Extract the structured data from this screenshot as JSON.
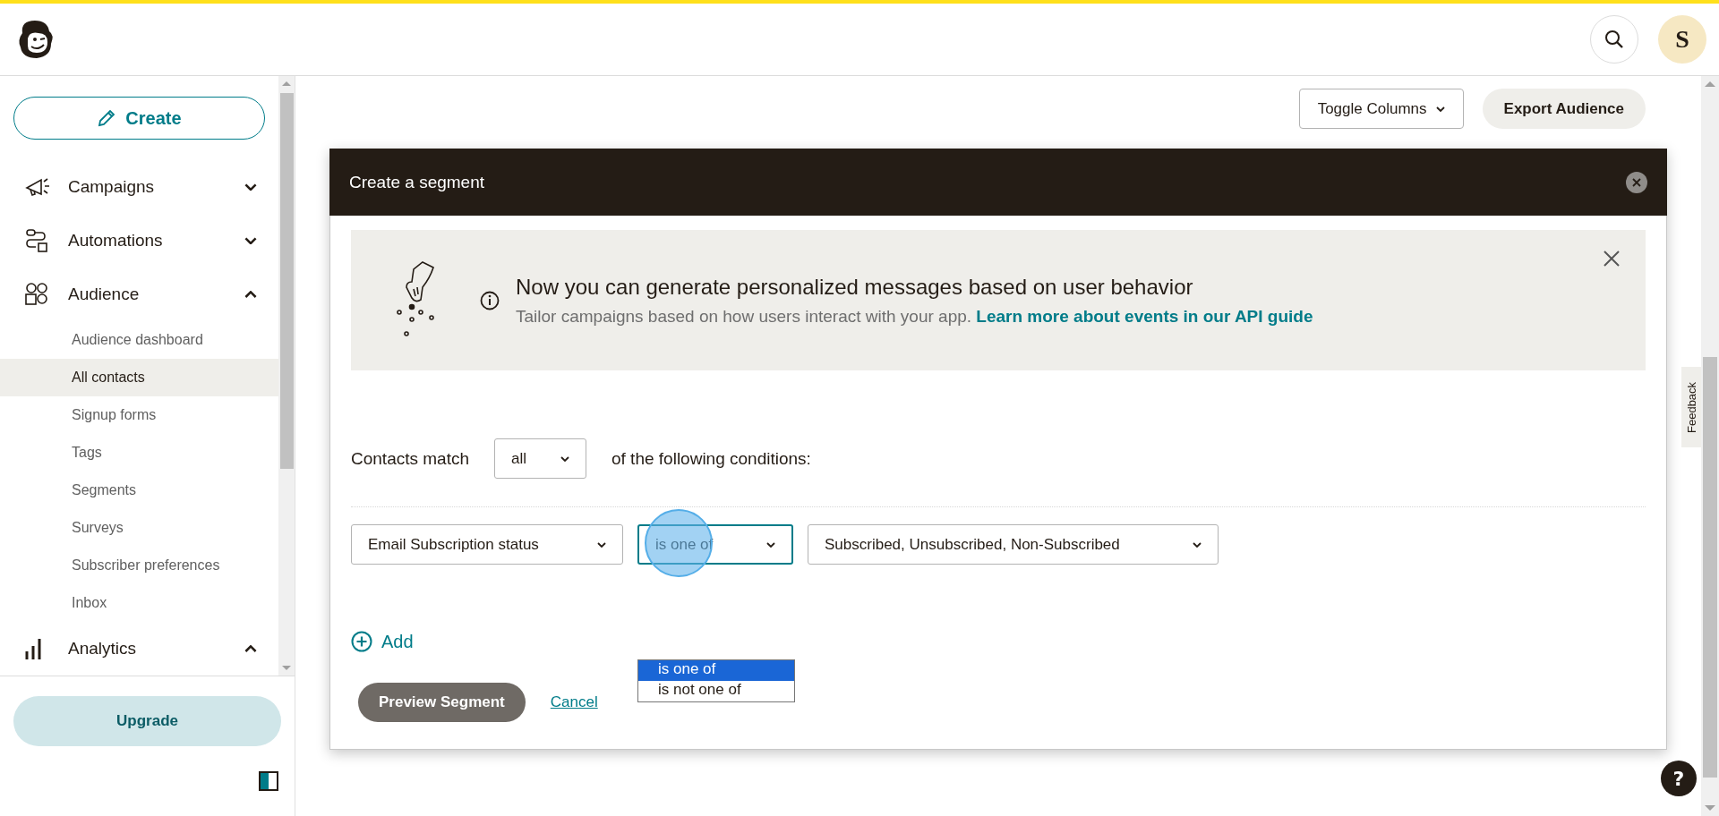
{
  "header": {
    "avatar_letter": "S"
  },
  "sidebar": {
    "create_label": "Create",
    "nav": [
      {
        "label": "Campaigns",
        "expanded": false
      },
      {
        "label": "Automations",
        "expanded": false
      },
      {
        "label": "Audience",
        "expanded": true,
        "children": [
          {
            "label": "Audience dashboard",
            "selected": false
          },
          {
            "label": "All contacts",
            "selected": true
          },
          {
            "label": "Signup forms",
            "selected": false
          },
          {
            "label": "Tags",
            "selected": false
          },
          {
            "label": "Segments",
            "selected": false
          },
          {
            "label": "Surveys",
            "selected": false
          },
          {
            "label": "Subscriber preferences",
            "selected": false
          },
          {
            "label": "Inbox",
            "selected": false
          }
        ]
      },
      {
        "label": "Analytics",
        "expanded": true
      }
    ],
    "upgrade_label": "Upgrade"
  },
  "toolbar": {
    "toggle_columns": "Toggle Columns",
    "export": "Export Audience"
  },
  "modal": {
    "title": "Create a segment",
    "banner": {
      "title": "Now you can generate personalized messages based on user behavior",
      "text": "Tailor campaigns based on how users interact with your app.",
      "link": "Learn more about events in our API guide"
    },
    "match": {
      "label": "Contacts match",
      "value": "all",
      "suffix": "of the following conditions:"
    },
    "conditions": [
      {
        "field": "Email Subscription status",
        "operator": "is one of",
        "operator_open": true,
        "operator_clicked": true,
        "operator_options": [
          {
            "label": "is one of",
            "selected": true
          },
          {
            "label": "is not one of",
            "selected": false
          }
        ],
        "value": "Subscribed, Unsubscribed, Non-Subscribed"
      }
    ],
    "add_label": "Add",
    "preview_label": "Preview Segment",
    "cancel_label": "Cancel"
  },
  "feedback_label": "Feedback",
  "help_label": "?"
}
